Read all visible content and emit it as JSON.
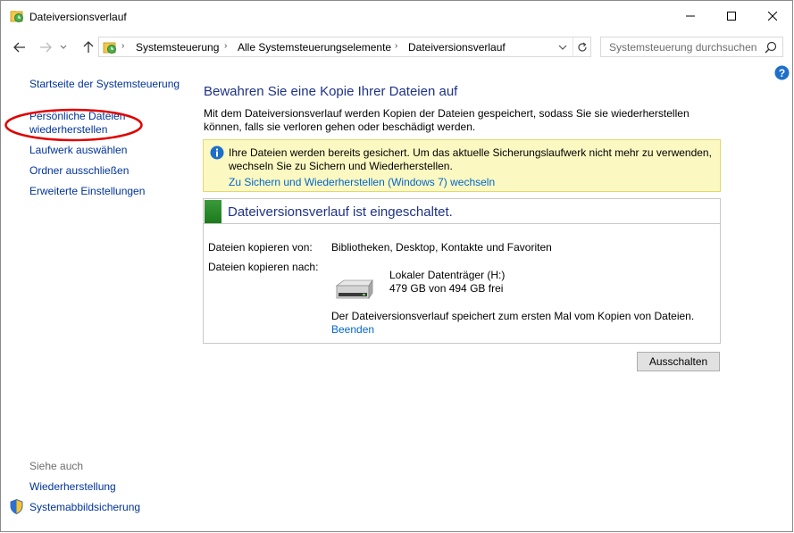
{
  "window": {
    "title": "Dateiversionsverlauf",
    "app_icon": "file-history-icon",
    "controls": [
      "minimize-icon",
      "maximize-icon",
      "close-icon"
    ]
  },
  "navigation": {
    "breadcrumb": [
      "Systemsteuerung",
      "Alle Systemsteuerungselemente",
      "Dateiversionsverlauf"
    ],
    "separator": "›",
    "search_placeholder": "Systemsteuerung durchsuchen"
  },
  "sidebar": {
    "home": "Startseite der Systemsteuerung",
    "restore_line1": "Persönliche Dateien",
    "restore_line2": "wiederherstellen",
    "select_drive": "Laufwerk auswählen",
    "exclude_folders": "Ordner ausschließen",
    "advanced": "Erweiterte Einstellungen",
    "see_also": "Siehe auch",
    "recovery": "Wiederherstellung",
    "system_image": "Systemabbildsicherung"
  },
  "main": {
    "heading": "Bewahren Sie eine Kopie Ihrer Dateien auf",
    "description": "Mit dem Dateiversionsverlauf werden Kopien der Dateien gespeichert, sodass Sie sie wiederherstellen können, falls sie verloren gehen oder beschädigt werden.",
    "info": {
      "text": "Ihre Dateien werden bereits gesichert. Um das aktuelle Sicherungslaufwerk nicht mehr zu verwenden, wechseln Sie zu Sichern und Wiederherstellen.",
      "link": "Zu Sichern und Wiederherstellen (Windows 7) wechseln"
    },
    "status": {
      "title": "Dateiversionsverlauf ist eingeschaltet.",
      "status_color": "#2a8a2a",
      "copy_from_label": "Dateien kopieren von:",
      "copy_from_value": "Bibliotheken, Desktop, Kontakte und Favoriten",
      "copy_to_label": "Dateien kopieren nach:",
      "drive_name": "Lokaler Datenträger (H:)",
      "drive_free": "479 GB von 494 GB frei",
      "first_save": "Der Dateiversionsverlauf speichert zum ersten Mal vom Kopien von Dateien.",
      "stop_link": "Beenden"
    },
    "turn_off_button": "Ausschalten"
  },
  "colors": {
    "link": "#003399",
    "heading": "#1e3287",
    "info_bg": "#fbf8c1",
    "annotation": "#e00000"
  }
}
